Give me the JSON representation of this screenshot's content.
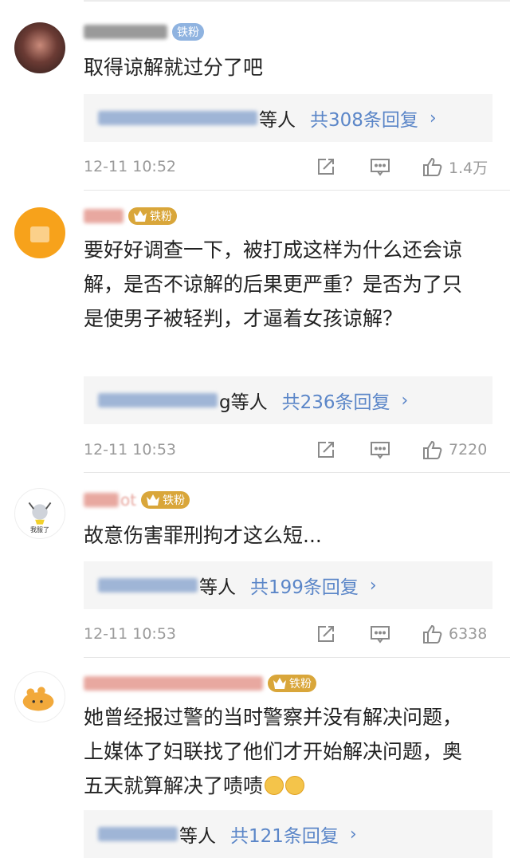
{
  "comments": [
    {
      "badge": "铁粉",
      "text": "取得谅解就过分了吧",
      "reply_suffix": "等人",
      "reply_count": "共308条回复",
      "time": "12-11 10:52",
      "likes": "1.4万"
    },
    {
      "badge": "铁粉",
      "text": "要好好调查一下，被打成这样为什么还会谅解，是否不谅解的后果更严重？是否为了只是使男子被轻判，才逼着女孩谅解？",
      "reply_suffix": "g等人",
      "reply_count": "共236条回复",
      "time": "12-11 10:53",
      "likes": "7220"
    },
    {
      "badge": "铁粉",
      "name_tail": "ot",
      "avatar_caption": "我服了",
      "text": "故意伤害罪刑拘才这么短...",
      "reply_suffix": "等人",
      "reply_count": "共199条回复",
      "time": "12-11 10:53",
      "likes": "6338"
    },
    {
      "badge": "铁粉",
      "text": "她曾经报过警的当时警察并没有解决问题，上媒体了妇联找了他们才开始解决问题，奥五天就算解决了啧啧",
      "reply_suffix": "等人",
      "reply_count": "共121条回复"
    }
  ],
  "colors": {
    "link": "#5b86c8",
    "meta": "#9a9a9a",
    "badge_gold": "#d9a63a",
    "badge_blue": "#8fb3e0"
  },
  "icons": [
    "share-icon",
    "comment-icon",
    "like-icon",
    "crown-icon",
    "chevron-right-icon"
  ]
}
